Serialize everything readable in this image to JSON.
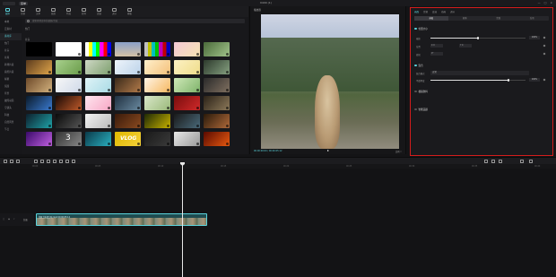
{
  "titlebar": {
    "menu_label": "菜单",
    "title": "0409 (1)",
    "controls": [
      "—",
      "□",
      "×"
    ]
  },
  "toolbar": {
    "tools": [
      {
        "label": "媒体",
        "icon": "media-icon",
        "active": true
      },
      {
        "label": "音频",
        "icon": "audio-icon"
      },
      {
        "label": "文本",
        "icon": "text-icon"
      },
      {
        "label": "贴纸",
        "icon": "sticker-icon"
      },
      {
        "label": "特效",
        "icon": "effects-icon"
      },
      {
        "label": "转场",
        "icon": "transition-icon"
      },
      {
        "label": "滤镜",
        "icon": "filter-icon"
      },
      {
        "label": "调节",
        "icon": "adjust-icon"
      },
      {
        "label": "模板",
        "icon": "template-icon"
      }
    ]
  },
  "library": {
    "side_items": [
      "本地",
      "云素材",
      "素材库",
      "热门",
      "片头",
      "片尾",
      "转场片段",
      "搞笑片段",
      "绿幕",
      "氛围",
      "背景",
      "故障动画",
      "空镜头",
      "科技",
      "自然风景",
      "节日"
    ],
    "active_index": 2,
    "search_placeholder": "搜索素材库中的视频/音效",
    "section_hot": "热门",
    "section_recent": "片头"
  },
  "thumbs": [
    {
      "bg": "#000000"
    },
    {
      "bg": "#ffffff"
    },
    {
      "bg": "linear-gradient(90deg,#fff 0 14%,#ff0 14% 28%,#0ff 28% 42%,#0f0 42% 56%,#f0f 56% 70%,#f00 70% 84%,#00f 84%)"
    },
    {
      "bg": "linear-gradient(180deg,#8aa0c8,#d4c1a5)"
    },
    {
      "bg": "linear-gradient(90deg,#c0c0c0 0 14%,#c0c000 14% 28%,#00c0c0 28% 42%,#00c000 42% 56%,#c000c0 56% 70%,#c00000 70% 84%,#0000c0 84%)"
    },
    {
      "bg": "linear-gradient(135deg,#f3c9d6,#f6e3b2)"
    },
    {
      "bg": "linear-gradient(135deg,#4a6a3a,#a2c48b)"
    },
    {
      "bg": "linear-gradient(135deg,#5a3a1d,#e0a54a)"
    },
    {
      "bg": "linear-gradient(135deg,#a8d08d,#6a9c4a)"
    },
    {
      "bg": "linear-gradient(135deg,#cfd8c5,#7d9f6e)"
    },
    {
      "bg": "linear-gradient(135deg,#eef4fb,#bcd3e9)"
    },
    {
      "bg": "linear-gradient(135deg,#fff0cc,#f4c07a)"
    },
    {
      "bg": "linear-gradient(135deg,#fdf1c4,#efdd8a)"
    },
    {
      "bg": "linear-gradient(135deg,#2d3a2d,#86a080)"
    },
    {
      "bg": "linear-gradient(135deg,#6e4a2a,#d3b27e)"
    },
    {
      "bg": "linear-gradient(135deg,#f7f7f7,#cfd9e8)"
    },
    {
      "bg": "linear-gradient(135deg,#dff3f7,#a9dbe5)"
    },
    {
      "bg": "linear-gradient(135deg,#3a2a1a,#b37b4a)"
    },
    {
      "bg": "linear-gradient(135deg,#fff4e5,#f6b860)"
    },
    {
      "bg": "linear-gradient(135deg,#cfe8b8,#7eb36a)"
    },
    {
      "bg": "linear-gradient(135deg,#2a2a2a,#807060)"
    },
    {
      "bg": "linear-gradient(135deg,#0a1a2a,#3a7ad0)"
    },
    {
      "bg": "linear-gradient(135deg,#1a0a05,#c05a2a)"
    },
    {
      "bg": "linear-gradient(135deg,#ffe6f0,#f7a7c4)"
    },
    {
      "bg": "linear-gradient(135deg,#203040,#6a8aa0)"
    },
    {
      "bg": "linear-gradient(135deg,#d9e7c9,#9ab97a)"
    },
    {
      "bg": "linear-gradient(135deg,#7a0d0d,#d02a2a)"
    },
    {
      "bg": "linear-gradient(135deg,#2b2218,#8d7a5a)"
    },
    {
      "bg": "linear-gradient(135deg,#0d1f2d,#1fa3a8)"
    },
    {
      "bg": "linear-gradient(135deg,#0a0a0a,#555)"
    },
    {
      "bg": "linear-gradient(135deg,#f2f2f2,#bbb)"
    },
    {
      "bg": "linear-gradient(135deg,#3a1a0a,#8a4a20)"
    },
    {
      "bg": "linear-gradient(135deg,#1f2a05,#c8b200)"
    },
    {
      "bg": "linear-gradient(135deg,#1a1a1a,#4a6a7a)"
    },
    {
      "bg": "linear-gradient(135deg,#2a1a0a,#b06a3a)"
    },
    {
      "bg": "linear-gradient(135deg,#3a0a6a,#c060e0)"
    },
    {
      "bg": "linear-gradient(135deg,#333,#888)"
    },
    {
      "bg": "linear-gradient(135deg,#0a3a4a,#2ab0c0)"
    },
    {
      "bg": "linear-gradient(135deg,#e0b800,#f5d23a)"
    },
    {
      "bg": "linear-gradient(135deg,#1a1a1a,#3a3a3a)"
    },
    {
      "bg": "linear-gradient(135deg,#e8e8e8,#999)"
    },
    {
      "bg": "linear-gradient(135deg,#5a0a00,#e85a10)"
    }
  ],
  "thumb_text": {
    "vlog": "VLOG",
    "three": "3"
  },
  "player": {
    "title": "播放器",
    "time": "00:00:00:00 / 00:00:05:12",
    "ctrl_text": "比例 ⛶"
  },
  "inspector": {
    "tabs": [
      "画面",
      "音频",
      "变速",
      "动画",
      "调节"
    ],
    "active_tab": 0,
    "subtabs": [
      "基础",
      "抠像",
      "蒙版",
      "背景"
    ],
    "active_subtab": 0,
    "group_position": "位置大小",
    "scale_label": "缩放",
    "scale_value": "100%",
    "pos_label": "位置",
    "x_label": "X",
    "x_value": "0",
    "y_label": "Y",
    "y_value": "0",
    "rotate_label": "旋转",
    "rotate_value": "0°",
    "group_blend": "混合",
    "blend_mode_label": "混合模式",
    "blend_mode_value": "正常",
    "opacity_label": "不透明度",
    "opacity_value": "100%",
    "group_stabilize": "视频防抖",
    "group_curve": "智能美颜",
    "blend_accent": "#5ad3dc",
    "border_color": "#d41c1c"
  },
  "inspector_values": {
    "scale_fraction": 0.5,
    "opacity_fraction": 0.82
  },
  "timeline": {
    "ticks": [
      "00:00",
      "00:05",
      "00:10",
      "00:15",
      "00:20",
      "00:25",
      "00:30",
      "00:35",
      "00:40"
    ],
    "clip_label": "草原土拨鼠大叫.mp4  00:00:05:12",
    "track_label": "封面"
  }
}
